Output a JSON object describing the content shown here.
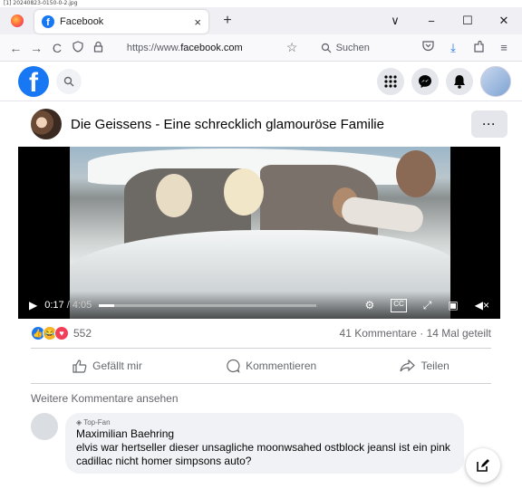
{
  "screenshot_caption": "[1] 20240823-0150-0-2.jpg",
  "browser": {
    "tab_title": "Facebook",
    "tab_close": "×",
    "new_tab": "+",
    "tab_list": "∨",
    "minimize": "−",
    "maximize": "☐",
    "close": "✕",
    "back": "←",
    "forward": "→",
    "reload": "C",
    "url_prefix": "https://www.",
    "url_domain": "facebook.com",
    "search_placeholder": "Suchen",
    "icons": [
      "shield-icon",
      "lock-icon",
      "star-icon",
      "pocket-icon",
      "download-icon",
      "extensions-icon",
      "menu-icon"
    ]
  },
  "fb": {
    "logo": "f",
    "brand_color": "#1877f2",
    "header_icons": [
      "menu-grid-icon",
      "messenger-icon",
      "notifications-icon",
      "account-avatar"
    ]
  },
  "page": {
    "title": "Die Geissens - Eine schrecklich glamouröse Familie",
    "more": "···"
  },
  "video": {
    "current_time": "0:17",
    "duration": "/ 4:05",
    "progress": 0.07
  },
  "stats": {
    "reactions": [
      "like",
      "haha",
      "love"
    ],
    "reaction_count": "552",
    "comments": "41 Kommentare",
    "separator": "·",
    "shares": "14 Mal geteilt"
  },
  "actions": {
    "like": "Gefällt mir",
    "comment": "Kommentieren",
    "share": "Teilen"
  },
  "more_comments": "Weitere Kommentare ansehen",
  "comment": {
    "badge": "Top-Fan",
    "author": "Maximilian Baehring",
    "text": "elvis war hertseller dieser unsagliche moonwsahed ostblock jeansl ist ein pink cadillac nicht homer simpsons auto?"
  }
}
